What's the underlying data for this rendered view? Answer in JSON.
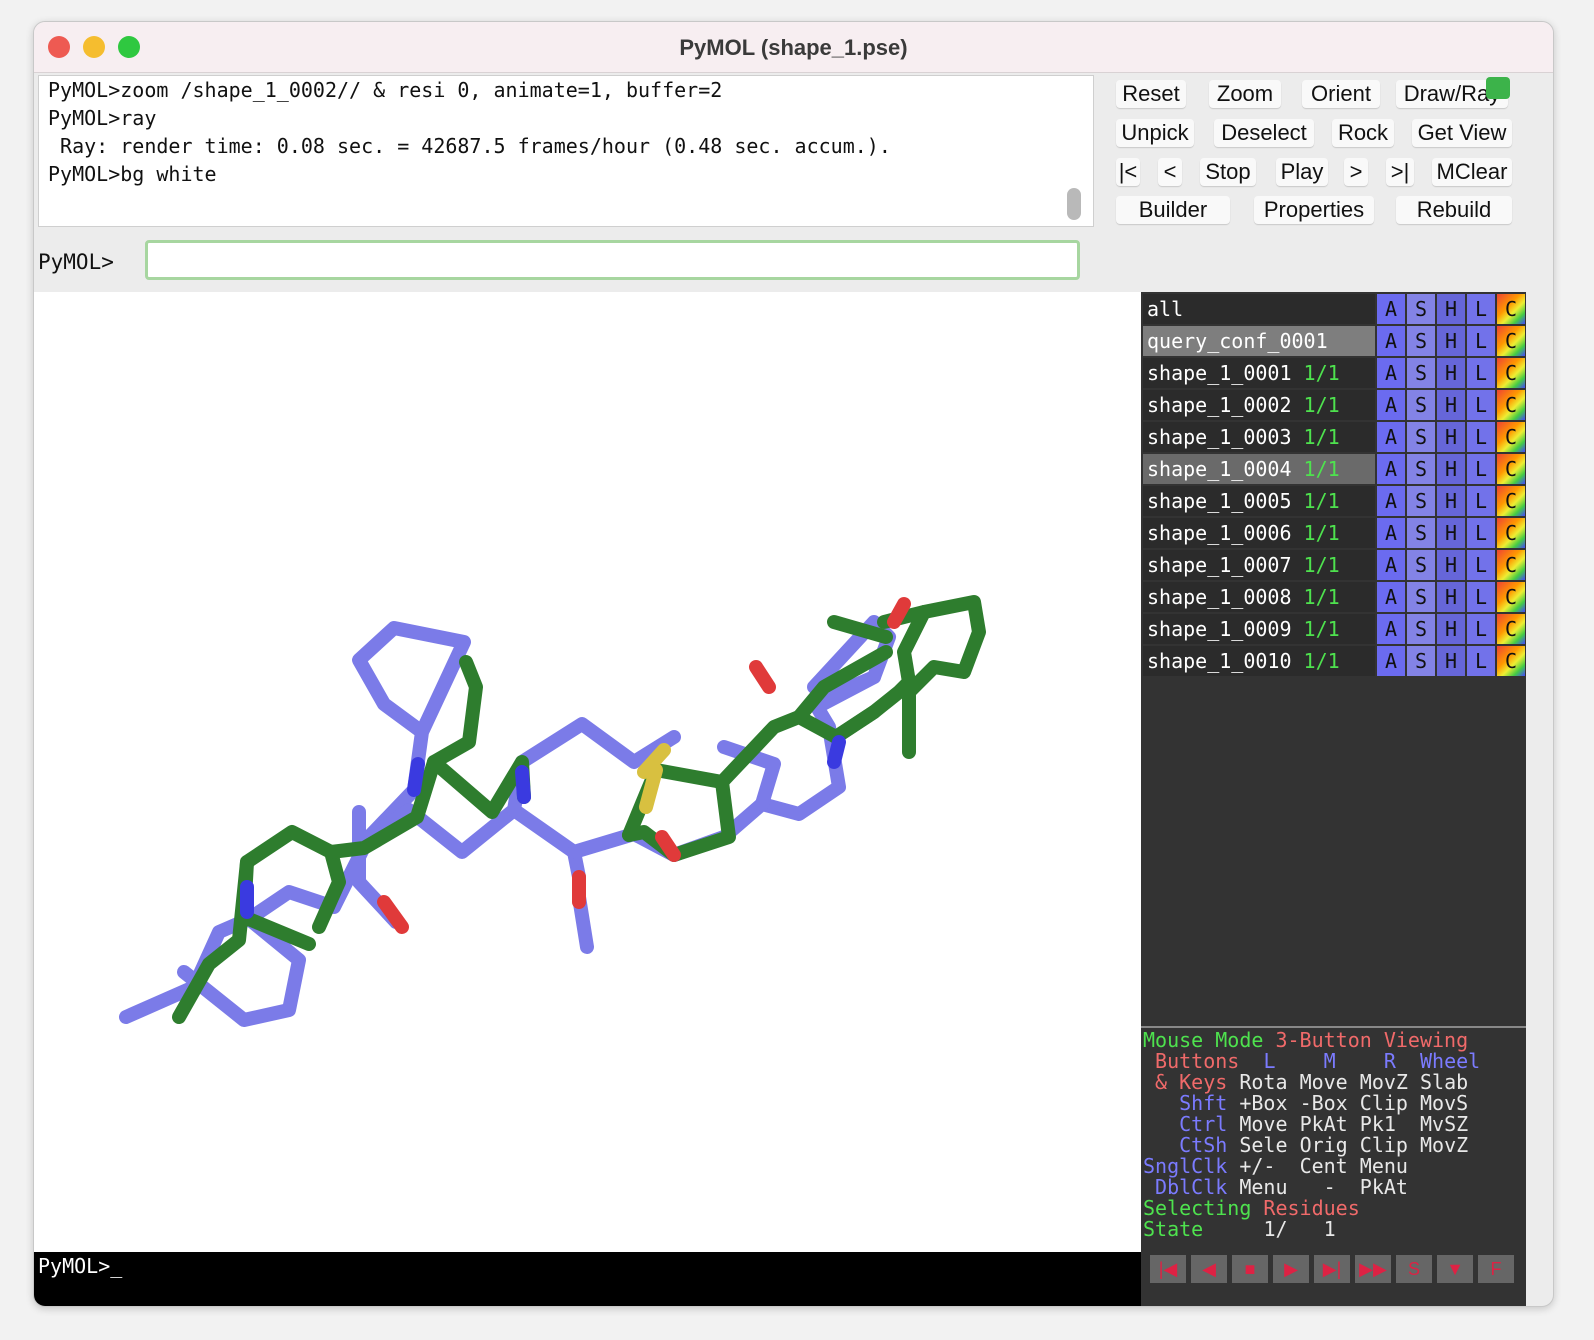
{
  "window": {
    "title": "PyMOL (shape_1.pse)"
  },
  "log": {
    "lines": [
      "PyMOL>zoom /shape_1_0002// & resi 0, animate=1, buffer=2",
      "PyMOL>ray",
      " Ray: render time: 0.08 sec. = 42687.5 frames/hour (0.48 sec. accum.).",
      "PyMOL>bg white"
    ]
  },
  "command": {
    "prompt": "PyMOL>",
    "value": ""
  },
  "toolbar": {
    "row1": [
      "Reset",
      "Zoom",
      "Orient",
      "Draw/Ray"
    ],
    "row2": [
      "Unpick",
      "Deselect",
      "Rock",
      "Get View"
    ],
    "row3": [
      "|<",
      "<",
      "Stop",
      "Play",
      ">",
      ">|",
      "MClear"
    ],
    "row4": [
      "Builder",
      "Properties",
      "Rebuild"
    ]
  },
  "objects": [
    {
      "name": "all",
      "state": ""
    },
    {
      "name": "query_conf_0001",
      "state": ""
    },
    {
      "name": "shape_1_0001",
      "state": "1/1"
    },
    {
      "name": "shape_1_0002",
      "state": "1/1"
    },
    {
      "name": "shape_1_0003",
      "state": "1/1"
    },
    {
      "name": "shape_1_0004",
      "state": "1/1"
    },
    {
      "name": "shape_1_0005",
      "state": "1/1"
    },
    {
      "name": "shape_1_0006",
      "state": "1/1"
    },
    {
      "name": "shape_1_0007",
      "state": "1/1"
    },
    {
      "name": "shape_1_0008",
      "state": "1/1"
    },
    {
      "name": "shape_1_0009",
      "state": "1/1"
    },
    {
      "name": "shape_1_0010",
      "state": "1/1"
    }
  ],
  "object_buttons": [
    "A",
    "S",
    "H",
    "L",
    "C"
  ],
  "mouse_mode": {
    "title_a": "Mouse Mode",
    "title_b": "3-Button Viewing",
    "buttons_label": "Buttons",
    "cols": [
      "L",
      "M",
      "R",
      "Wheel"
    ],
    "keys_label": "& Keys",
    "keys": [
      "Rota",
      "Move",
      "MovZ",
      "Slab"
    ],
    "shft_label": "Shft",
    "shft": [
      "+Box",
      "-Box",
      "Clip",
      "MovS"
    ],
    "ctrl_label": "Ctrl",
    "ctrl": [
      "Move",
      "PkAt",
      "Pk1",
      "MvSZ"
    ],
    "ctsh_label": "CtSh",
    "ctsh": [
      "Sele",
      "Orig",
      "Clip",
      "MovZ"
    ],
    "sngl_label": "SnglClk",
    "sngl": [
      "+/-",
      "Cent",
      "Menu"
    ],
    "dbl_label": "DblClk",
    "dbl": [
      "Menu",
      "-",
      "PkAt"
    ],
    "selecting_a": "Selecting",
    "selecting_b": "Residues",
    "state_label": "State",
    "state_value": "1/",
    "state_total": "1"
  },
  "bottom_cmd": "PyMOL>_",
  "playback": [
    "|◀",
    "◀",
    "■",
    "▶",
    "▶|",
    "▶▶",
    "S",
    "▼",
    "F"
  ],
  "colors": {
    "carbon_green": "#2e7d2e",
    "nitrogen_blue": "#7b7be8",
    "oxygen_red": "#e03a3a",
    "sulfur_yellow": "#d8c040"
  }
}
